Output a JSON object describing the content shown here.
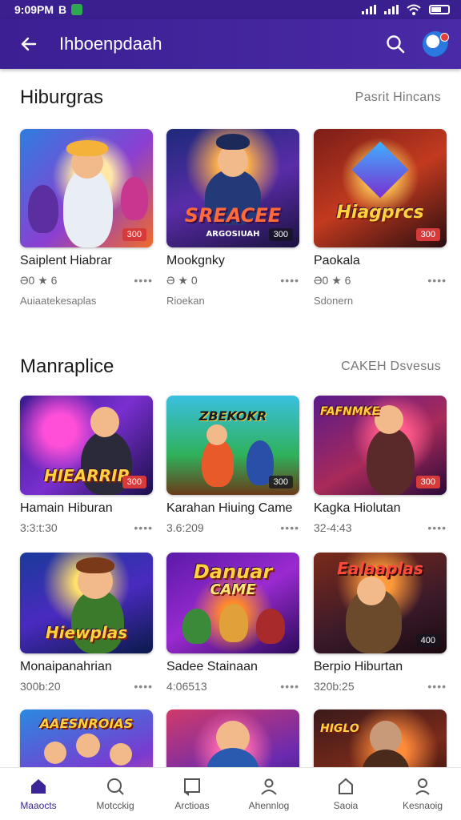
{
  "status": {
    "time": "9:09PM",
    "carrier": "B"
  },
  "app_bar": {
    "title": "Ihboenpdaah"
  },
  "sections": [
    {
      "title": "Hiburgras",
      "link": "Pasrit Hincans",
      "cards": [
        {
          "name": "Saiplent Hiabrar",
          "meta": "Ə0 ★ 6",
          "sub": "Auiaatekesaplas",
          "tag": "300",
          "art_title": ""
        },
        {
          "name": "Mookgnky",
          "meta": "Ə ★ 0",
          "sub": "Rioekan",
          "tag": "300",
          "art_title": "SREACEE",
          "art_subtitle": "ARGOSIUAH"
        },
        {
          "name": "Paokala",
          "meta": "Ə0 ★ 6",
          "sub": "Sdonern",
          "tag": "300",
          "art_title": "Hiagprcs"
        }
      ]
    },
    {
      "title": "Manraplice",
      "link": "CAKEH Dsvesus",
      "cards": [
        {
          "name": "Hamain Hiburan",
          "meta": "3:3:t:30",
          "tag": "300",
          "art_title": "HIEARRIP"
        },
        {
          "name": "Karahan Hiuing Came",
          "meta": "3.6:209",
          "tag": "300",
          "art_title": "ZBEKOKR"
        },
        {
          "name": "Kagka Hiolutan",
          "meta": "32-4:43",
          "tag": "300",
          "art_title": "FAFNMKE"
        },
        {
          "name": "Monaipanahrian",
          "meta": "300b:20",
          "tag": "",
          "art_title": "Hiewplas"
        },
        {
          "name": "Sadee Stainaan",
          "meta": "4:06513",
          "tag": "",
          "art_title": "Danuar",
          "art_subtitle": "CAME"
        },
        {
          "name": "Berpio Hiburtan",
          "meta": "320b:25",
          "tag": "400",
          "art_title": "Ealaaplas"
        },
        {
          "name": "",
          "meta": "",
          "tag": "",
          "art_title": "AAESNROIAS"
        },
        {
          "name": "",
          "meta": "",
          "tag": "",
          "art_title": ""
        },
        {
          "name": "",
          "meta": "",
          "tag": "",
          "art_title": "HIGLO"
        }
      ]
    }
  ],
  "bottom_nav": [
    {
      "label": "Maaocts",
      "icon": "home-icon"
    },
    {
      "label": "Motcckig",
      "icon": "search-icon"
    },
    {
      "label": "Arctioas",
      "icon": "library-icon"
    },
    {
      "label": "Ahennlog",
      "icon": "person-icon"
    },
    {
      "label": "Saoia",
      "icon": "bag-icon"
    },
    {
      "label": "Kesnaoig",
      "icon": "profile-icon"
    }
  ],
  "colors": {
    "primary": "#3b1f93",
    "accent": "#ffd23f",
    "tag_red": "#d63a3a"
  }
}
